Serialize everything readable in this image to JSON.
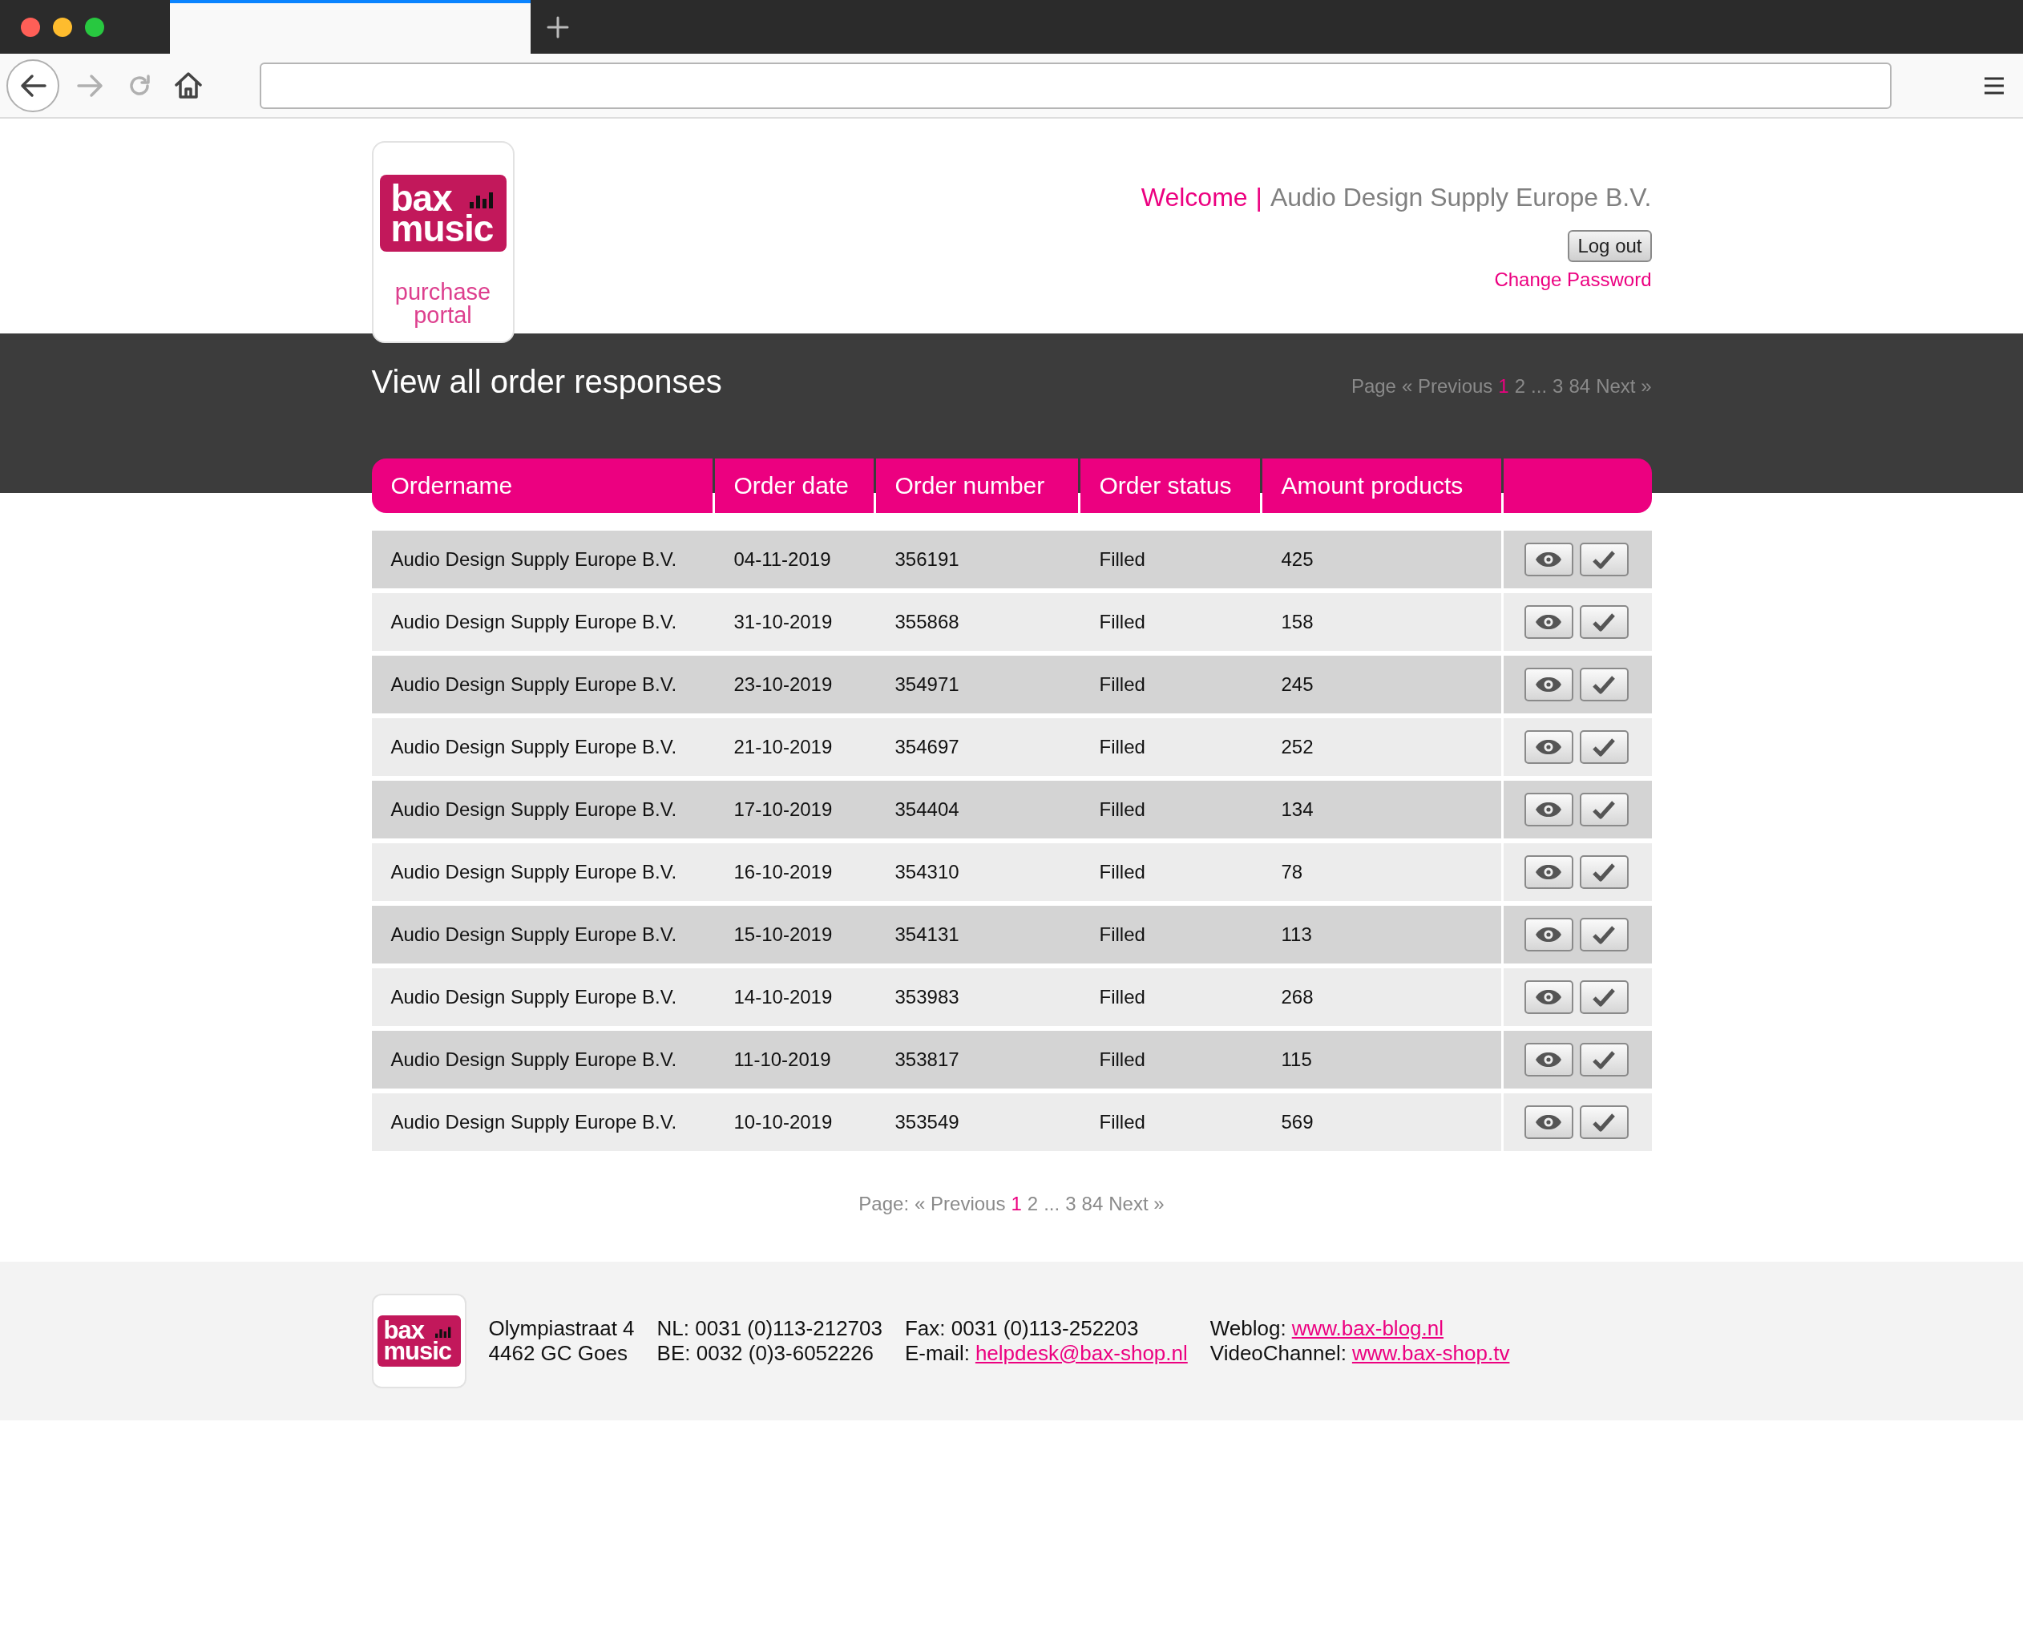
{
  "header": {
    "logo": {
      "brand_lines": [
        "bax",
        "music"
      ],
      "tagline_lines": [
        "purchase",
        "portal"
      ]
    },
    "welcome": "Welcome",
    "separator": "|",
    "company": "Audio Design Supply Europe B.V.",
    "logout_button": "Log out",
    "change_password_link": "Change Password"
  },
  "title": "View all order responses",
  "pagination_top": {
    "label": "Page",
    "items": [
      {
        "text": "« Previous",
        "selected": false
      },
      {
        "text": "1",
        "selected": true
      },
      {
        "text": "2",
        "selected": false
      },
      {
        "text": "...",
        "selected": false
      },
      {
        "text": "3",
        "selected": false
      },
      {
        "text": "84",
        "selected": false
      },
      {
        "text": "Next »",
        "selected": false
      }
    ]
  },
  "table": {
    "columns": [
      "Ordername",
      "Order date",
      "Order number",
      "Order status",
      "Amount products"
    ],
    "rows": [
      {
        "ordername": "Audio Design Supply Europe B.V.",
        "order_date": "04-11-2019",
        "order_number": "356191",
        "order_status": "Filled",
        "amount_products": "425"
      },
      {
        "ordername": "Audio Design Supply Europe B.V.",
        "order_date": "31-10-2019",
        "order_number": "355868",
        "order_status": "Filled",
        "amount_products": "158"
      },
      {
        "ordername": "Audio Design Supply Europe B.V.",
        "order_date": "23-10-2019",
        "order_number": "354971",
        "order_status": "Filled",
        "amount_products": "245"
      },
      {
        "ordername": "Audio Design Supply Europe B.V.",
        "order_date": "21-10-2019",
        "order_number": "354697",
        "order_status": "Filled",
        "amount_products": "252"
      },
      {
        "ordername": "Audio Design Supply Europe B.V.",
        "order_date": "17-10-2019",
        "order_number": "354404",
        "order_status": "Filled",
        "amount_products": "134"
      },
      {
        "ordername": "Audio Design Supply Europe B.V.",
        "order_date": "16-10-2019",
        "order_number": "354310",
        "order_status": "Filled",
        "amount_products": "78"
      },
      {
        "ordername": "Audio Design Supply Europe B.V.",
        "order_date": "15-10-2019",
        "order_number": "354131",
        "order_status": "Filled",
        "amount_products": "113"
      },
      {
        "ordername": "Audio Design Supply Europe B.V.",
        "order_date": "14-10-2019",
        "order_number": "353983",
        "order_status": "Filled",
        "amount_products": "268"
      },
      {
        "ordername": "Audio Design Supply Europe B.V.",
        "order_date": "11-10-2019",
        "order_number": "353817",
        "order_status": "Filled",
        "amount_products": "115"
      },
      {
        "ordername": "Audio Design Supply Europe B.V.",
        "order_date": "10-10-2019",
        "order_number": "353549",
        "order_status": "Filled",
        "amount_products": "569"
      }
    ]
  },
  "pagination_bottom": {
    "label": "Page:",
    "items": [
      {
        "text": "« Previous",
        "selected": false
      },
      {
        "text": "1",
        "selected": true
      },
      {
        "text": "2",
        "selected": false
      },
      {
        "text": "...",
        "selected": false
      },
      {
        "text": "3",
        "selected": false
      },
      {
        "text": "84",
        "selected": false
      },
      {
        "text": "Next »",
        "selected": false
      }
    ]
  },
  "footer": {
    "logo": {
      "brand_lines": [
        "bax",
        "music"
      ]
    },
    "columns": [
      [
        {
          "label": "Olympiastraat 4"
        },
        {
          "label": "4462 GC Goes"
        }
      ],
      [
        {
          "label": "NL: 0031 (0)113-212703"
        },
        {
          "label": "BE: 0032 (0)3-6052226"
        }
      ],
      [
        {
          "label": "Fax: 0031 (0)113-252203"
        },
        {
          "label": "E-mail:",
          "link": "helpdesk@bax-shop.nl"
        }
      ],
      [
        {
          "label": "Weblog:",
          "link": "www.bax-blog.nl"
        },
        {
          "label": "VideoChannel:",
          "link": "www.bax-shop.tv"
        }
      ]
    ]
  }
}
